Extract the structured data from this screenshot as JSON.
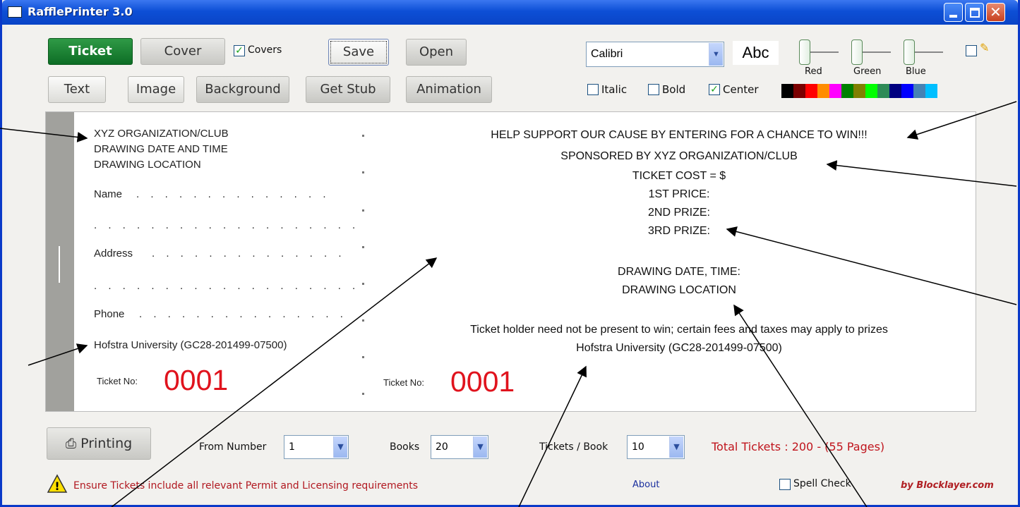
{
  "window": {
    "title": "RafflePrinter 3.0"
  },
  "toolbar": {
    "ticket": "Ticket",
    "cover": "Cover",
    "covers_label": "Covers",
    "save": "Save",
    "open": "Open",
    "text": "Text",
    "image": "Image",
    "background": "Background",
    "get_stub": "Get Stub",
    "animation": "Animation"
  },
  "font": {
    "selected": "Calibri",
    "preview": "Abc",
    "italic": "Italic",
    "bold": "Bold",
    "center": "Center"
  },
  "sliders": {
    "red": "Red",
    "green": "Green",
    "blue": "Blue"
  },
  "palette": [
    "#000000",
    "#7a0000",
    "#ff0000",
    "#ff8c00",
    "#ff00ff",
    "#008000",
    "#808000",
    "#00ff00",
    "#2e8b57",
    "#000080",
    "#0000ff",
    "#4682b4",
    "#00bfff"
  ],
  "stub": {
    "line1": "XYZ ORGANIZATION/CLUB",
    "line2": "DRAWING DATE AND TIME",
    "line3": "DRAWING LOCATION",
    "name": "Name",
    "address": "Address",
    "phone": "Phone",
    "license": "Hofstra University (GC28-201499-07500)",
    "ticket_no_label": "Ticket No:",
    "ticket_no": "0001"
  },
  "main": {
    "line1": "HELP SUPPORT OUR CAUSE BY ENTERING FOR A CHANCE TO WIN!!!",
    "line2": "SPONSORED BY XYZ ORGANIZATION/CLUB",
    "line3": "TICKET COST = $",
    "line4": "1ST PRICE:",
    "line5": "2ND PRIZE:",
    "line6": "3RD PRIZE:",
    "line7": "DRAWING DATE, TIME:",
    "line8": "DRAWING LOCATION",
    "line9": "Ticket holder need not be present to win; certain fees and taxes may apply to prizes",
    "line10": "Hofstra University (GC28-201499-07500)",
    "ticket_no_label": "Ticket No:",
    "ticket_no": "0001"
  },
  "printing": {
    "button": "Printing",
    "from_label": "From Number",
    "from_value": "1",
    "books_label": "Books",
    "books_value": "20",
    "tpb_label": "Tickets / Book",
    "tpb_value": "10",
    "total": "Total Tickets : 200 - (55 Pages)"
  },
  "footer": {
    "warning": "Ensure Tickets include all relevant Permit and Licensing requirements",
    "about": "About",
    "spell_check": "Spell Check",
    "credit": "by Blocklayer.com"
  }
}
